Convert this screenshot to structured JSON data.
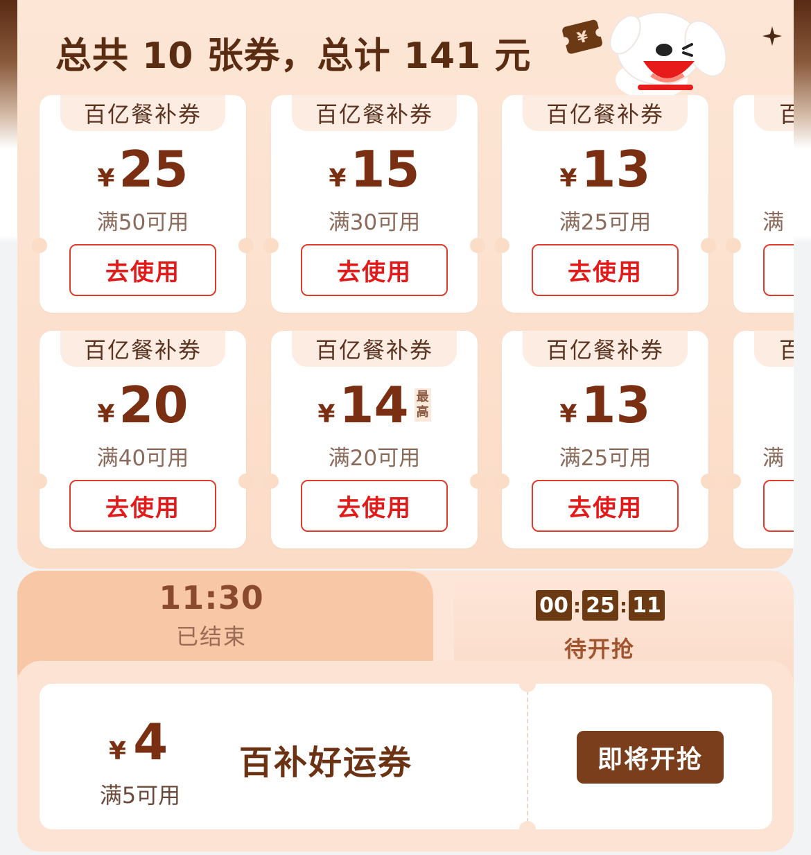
{
  "summary": {
    "title": "总共 10 张券，总计 141 元"
  },
  "coupons": [
    {
      "tag": "百亿餐补券",
      "yen": "¥",
      "amount": "25",
      "condition": "满50可用",
      "button": "去使用"
    },
    {
      "tag": "百亿餐补券",
      "yen": "¥",
      "amount": "15",
      "condition": "满30可用",
      "button": "去使用"
    },
    {
      "tag": "百亿餐补券",
      "yen": "¥",
      "amount": "13",
      "condition": "满25可用",
      "button": "去使用"
    },
    {
      "tag": "百",
      "yen": "",
      "amount": "",
      "condition": "满",
      "button": ""
    },
    {
      "tag": "百亿餐补券",
      "yen": "¥",
      "amount": "20",
      "condition": "满40可用",
      "button": "去使用"
    },
    {
      "tag": "百亿餐补券",
      "yen": "¥",
      "amount": "14",
      "badge": "最高",
      "condition": "满20可用",
      "button": "去使用"
    },
    {
      "tag": "百亿餐补券",
      "yen": "¥",
      "amount": "13",
      "condition": "满25可用",
      "button": "去使用"
    },
    {
      "tag": "百",
      "yen": "",
      "amount": "",
      "condition": "满",
      "button": ""
    }
  ],
  "session_tabs": {
    "past": {
      "time": "11:30",
      "status": "已结束"
    },
    "upcoming": {
      "countdown": [
        "00",
        "25",
        "11"
      ],
      "status": "待开抢"
    }
  },
  "lucky_coupon": {
    "yen": "¥",
    "amount": "4",
    "condition": "满5可用",
    "name": "百补好运券",
    "button": "即将开抢"
  },
  "icons": {
    "mascot": "joy-dog-mascot-icon",
    "ticket": "yen-ticket-icon",
    "sparkle": "sparkle-star-icon"
  },
  "colors": {
    "accent_red": "#e21a1a",
    "brown": "#7a2e12",
    "panel_peach": "#fbdcc7"
  }
}
